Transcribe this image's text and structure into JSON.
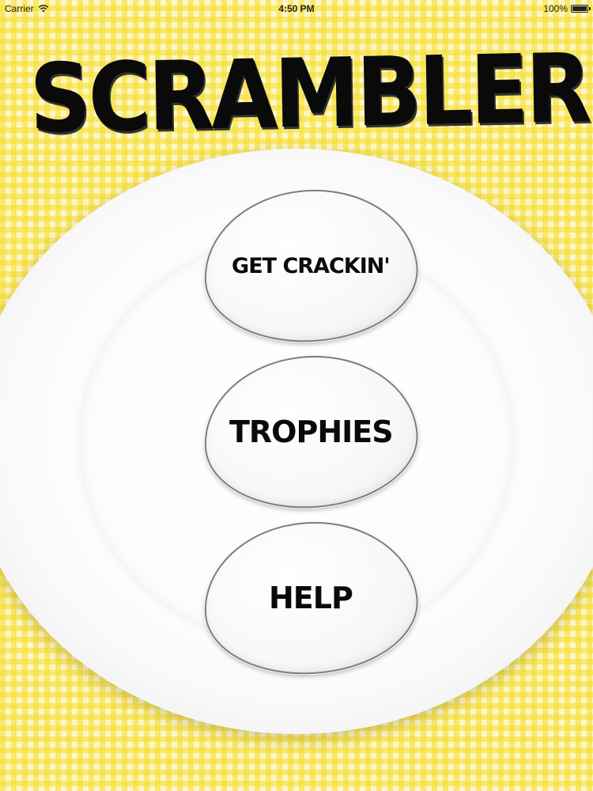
{
  "status_bar": {
    "carrier": "Carrier",
    "time": "4:50 PM",
    "battery": "100%",
    "battery_level": 1.0,
    "icons": [
      "wifi-icon",
      "battery-icon"
    ]
  },
  "title": "SCRAMBLER",
  "menu": {
    "get_crackin": "GET CRACKIN'",
    "trophies": "TROPHIES",
    "help": "HELP"
  },
  "colors": {
    "tablecloth_yellow": "#f6dc28",
    "tablecloth_light": "#fdf6c8",
    "plate": "#ffffff",
    "egg_outline": "#7d7d7d",
    "text": "#0a0a0a"
  }
}
